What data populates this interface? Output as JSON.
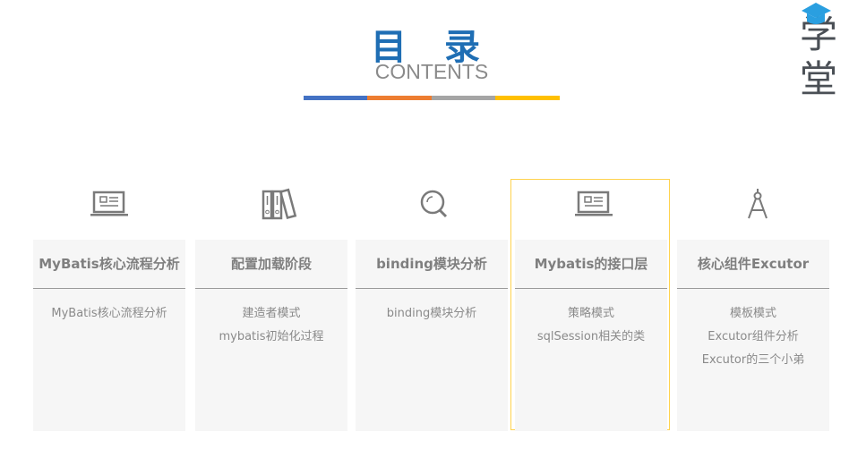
{
  "header": {
    "title": "目 录",
    "subtitle": "CONTENTS"
  },
  "logo": {
    "text": "学堂"
  },
  "colors": {
    "title": "#1f6eb4",
    "bars": [
      "#4472c4",
      "#ed7d31",
      "#a5a5a5",
      "#ffc000"
    ],
    "highlight": "#ffd24d",
    "logo_cap": "#2a9fe0"
  },
  "cards": [
    {
      "icon": "laptop-icon",
      "title": "MyBatis核心流程分析",
      "lines": [
        "MyBatis核心流程分析"
      ]
    },
    {
      "icon": "binders-icon",
      "title": "配置加载阶段",
      "lines": [
        "建造者模式",
        "mybatis初始化过程"
      ]
    },
    {
      "icon": "magnifier-icon",
      "title": "binding模块分析",
      "lines": [
        "binding模块分析"
      ]
    },
    {
      "icon": "laptop-icon",
      "title": "Mybatis的接口层",
      "lines": [
        "策略模式",
        "sqlSession相关的类"
      ]
    },
    {
      "icon": "compass-icon",
      "title": "核心组件Excutor",
      "lines": [
        "模板模式",
        "Excutor组件分析",
        "Excutor的三个小弟"
      ]
    }
  ]
}
